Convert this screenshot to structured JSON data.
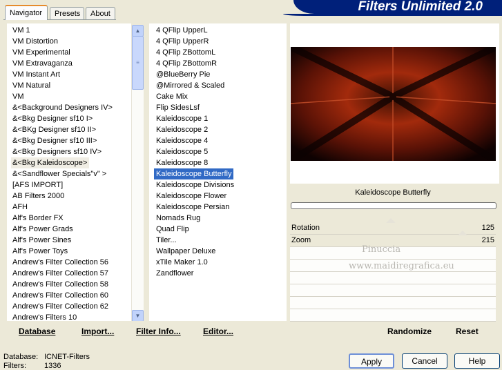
{
  "tabs": [
    "Navigator",
    "Presets",
    "About"
  ],
  "banner_title": "Filters Unlimited 2.0",
  "categories": [
    "VM 1",
    "VM Distortion",
    "VM Experimental",
    "VM Extravaganza",
    "VM Instant Art",
    "VM Natural",
    "VM",
    "&<Background Designers IV>",
    "&<Bkg Designer sf10 I>",
    "&<BKg Designer sf10 II>",
    "&<Bkg Designer sf10 III>",
    "&<Bkg Designers sf10 IV>",
    "&<Bkg Kaleidoscope>",
    "&<Sandflower Specials\"v\" >",
    "[AFS IMPORT]",
    "AB Filters 2000",
    "AFH",
    "Alf's Border FX",
    "Alf's Power Grads",
    "Alf's Power Sines",
    "Alf's Power Toys",
    "Andrew's Filter Collection 56",
    "Andrew's Filter Collection 57",
    "Andrew's Filter Collection 58",
    "Andrew's Filter Collection 60",
    "Andrew's Filter Collection 62",
    "Andrew's Filters 10"
  ],
  "filters": [
    "4 QFlip UpperL",
    "4 QFlip UpperR",
    "4 QFlip ZBottomL",
    "4 QFlip ZBottomR",
    "@BlueBerry Pie",
    "@Mirrored & Scaled",
    "Cake Mix",
    "Flip SidesLsf",
    "Kaleidoscope 1",
    "Kaleidoscope 2",
    "Kaleidoscope 4",
    "Kaleidoscope 5",
    "Kaleidoscope 8",
    "Kaleidoscope Butterfly",
    "Kaleidoscope Divisions",
    "Kaleidoscope Flower",
    "Kaleidoscope Persian",
    "Nomads Rug",
    "Quad Flip",
    "Tiler...",
    "Wallpaper Deluxe",
    "xTile Maker 1.0",
    "Zandflower"
  ],
  "selected_category": "&<Bkg Kaleidoscope>",
  "selected_filter": "Kaleidoscope Butterfly",
  "toolbar": {
    "database": "Database",
    "import": "Import...",
    "filter_info": "Filter Info...",
    "editor": "Editor..."
  },
  "right": {
    "filter_name": "Kaleidoscope Butterfly",
    "params": [
      {
        "label": "Rotation",
        "value": "125",
        "level": 0.49
      },
      {
        "label": "Zoom",
        "value": "215",
        "level": 0.84
      }
    ],
    "watermark_line1": "Pinuccia",
    "watermark_line2": "www.maidiregrafica.eu",
    "randomize": "Randomize",
    "reset": "Reset"
  },
  "status": {
    "database_label": "Database:",
    "database_value": "ICNET-Filters",
    "filters_label": "Filters:",
    "filters_value": "1336"
  },
  "buttons": {
    "apply": "Apply",
    "cancel": "Cancel",
    "help": "Help"
  },
  "colors": {
    "selection": "#316ac5",
    "banner": "#00207a",
    "tab_accent": "#e68b2c"
  }
}
